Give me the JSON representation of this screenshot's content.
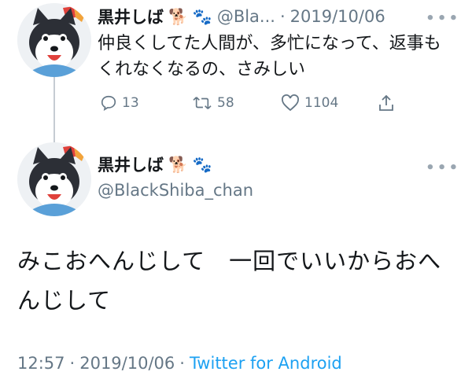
{
  "tweet1": {
    "display_name": "黒井しば",
    "name_emoji_dog": "🐕",
    "name_emoji_paws": "🐾",
    "handle": "@Bla...",
    "separator": "·",
    "date": "2019/10/06",
    "more_icon": "ellipsis-icon",
    "text": "仲良くしてた人間が、多忙になって、返事もくれなくなるの、さみしい",
    "actions": {
      "reply_count": "13",
      "retweet_count": "58",
      "like_count": "1104"
    }
  },
  "tweet2": {
    "display_name": "黒井しば",
    "name_emoji_dog": "🐕",
    "name_emoji_paws": "🐾",
    "handle": "@BlackShiba_chan",
    "more_icon": "ellipsis-icon",
    "text": "みこおへんじして　一回でいいからおへんじして",
    "time": "12:57",
    "separator": "·",
    "date": "2019/10/06",
    "separator2": "·",
    "source": "Twitter for Android"
  },
  "colors": {
    "text": "#14171a",
    "secondary": "#657786",
    "link": "#1da1f2"
  }
}
